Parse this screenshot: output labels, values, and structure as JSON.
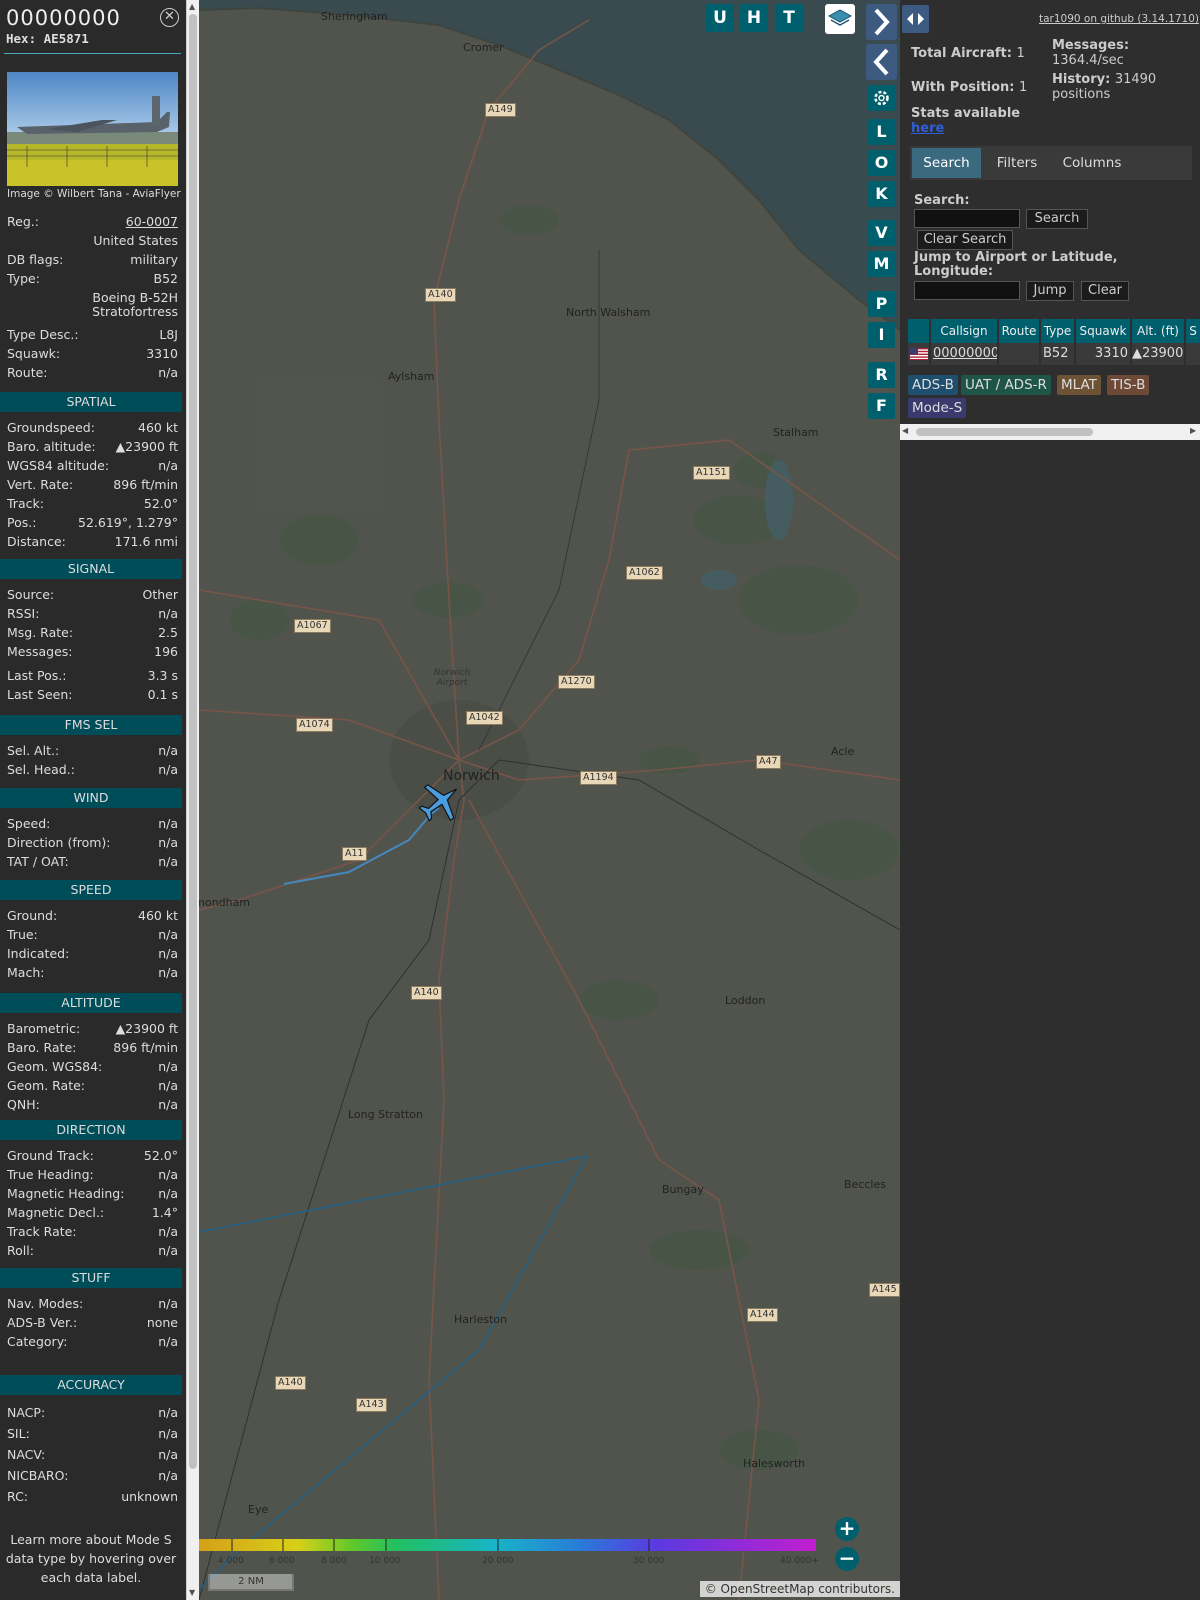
{
  "aircraft": {
    "callsign": "00000000",
    "hex_label": "Hex:",
    "hex": "AE5871",
    "close_icon": "close-icon",
    "photo_credit": "Image © Wilbert Tana - AviaFlyer"
  },
  "sidebar": {
    "rows_top": [
      {
        "label": "Reg.:",
        "value": "60-0007",
        "link": true
      },
      {
        "label": "",
        "value": "United States"
      },
      {
        "label": "DB flags:",
        "value": "military"
      },
      {
        "label": "Type:",
        "value": "B52"
      },
      {
        "label": "",
        "value": "Boeing B-52H"
      },
      {
        "label": "",
        "value": "Stratofortress"
      },
      {
        "label": "Type Desc.:",
        "value": "L8J"
      },
      {
        "label": "Squawk:",
        "value": "3310"
      },
      {
        "label": "Route:",
        "value": "n/a"
      }
    ],
    "sections": [
      {
        "title": "SPATIAL",
        "rows": [
          {
            "label": "Groundspeed:",
            "value": "460 kt"
          },
          {
            "label": "Baro. altitude:",
            "value": "▲23900 ft"
          },
          {
            "label": "WGS84 altitude:",
            "value": "n/a"
          },
          {
            "label": "Vert. Rate:",
            "value": "896 ft/min"
          },
          {
            "label": "Track:",
            "value": "52.0°"
          },
          {
            "label": "Pos.:",
            "value": "52.619°, 1.279°"
          },
          {
            "label": "Distance:",
            "value": "171.6 nmi"
          }
        ]
      },
      {
        "title": "SIGNAL",
        "rows": [
          {
            "label": "Source:",
            "value": "Other"
          },
          {
            "label": "RSSI:",
            "value": "n/a"
          },
          {
            "label": "Msg. Rate:",
            "value": "2.5"
          },
          {
            "label": "Messages:",
            "value": "196"
          },
          {
            "label": "Last Pos.:",
            "value": "3.3 s"
          },
          {
            "label": "Last Seen:",
            "value": "0.1 s"
          }
        ]
      },
      {
        "title": "FMS SEL",
        "rows": [
          {
            "label": "Sel. Alt.:",
            "value": "n/a"
          },
          {
            "label": "Sel. Head.:",
            "value": "n/a"
          }
        ]
      },
      {
        "title": "WIND",
        "rows": [
          {
            "label": "Speed:",
            "value": "n/a"
          },
          {
            "label": "Direction (from):",
            "value": "n/a"
          },
          {
            "label": "TAT / OAT:",
            "value": "n/a"
          }
        ]
      },
      {
        "title": "SPEED",
        "rows": [
          {
            "label": "Ground:",
            "value": "460 kt"
          },
          {
            "label": "True:",
            "value": "n/a"
          },
          {
            "label": "Indicated:",
            "value": "n/a"
          },
          {
            "label": "Mach:",
            "value": "n/a"
          }
        ]
      },
      {
        "title": "ALTITUDE",
        "rows": [
          {
            "label": "Barometric:",
            "value": "▲23900 ft"
          },
          {
            "label": "Baro. Rate:",
            "value": "896 ft/min"
          },
          {
            "label": "Geom. WGS84:",
            "value": "n/a"
          },
          {
            "label": "Geom. Rate:",
            "value": "n/a"
          },
          {
            "label": "QNH:",
            "value": "n/a"
          }
        ]
      },
      {
        "title": "DIRECTION",
        "rows": [
          {
            "label": "Ground Track:",
            "value": "52.0°"
          },
          {
            "label": "True Heading:",
            "value": "n/a"
          },
          {
            "label": "Magnetic Heading:",
            "value": "n/a"
          },
          {
            "label": "Magnetic Decl.:",
            "value": "1.4°"
          },
          {
            "label": "Track Rate:",
            "value": "n/a"
          },
          {
            "label": "Roll:",
            "value": "n/a"
          }
        ]
      },
      {
        "title": "STUFF",
        "rows": [
          {
            "label": "Nav. Modes:",
            "value": "n/a"
          },
          {
            "label": "ADS-B Ver.:",
            "value": "none"
          },
          {
            "label": "Category:",
            "value": "n/a"
          }
        ]
      },
      {
        "title": "ACCURACY",
        "rows": [
          {
            "label": "NACP:",
            "value": "n/a"
          },
          {
            "label": "SIL:",
            "value": "n/a"
          },
          {
            "label": "NACV:",
            "value": "n/a"
          },
          {
            "label": "NICBARO:",
            "value": "n/a"
          },
          {
            "label": "RC:",
            "value": "unknown"
          }
        ]
      }
    ],
    "learn_more": "Learn more about Mode S data type by hovering over each data label."
  },
  "map": {
    "top_buttons": [
      "U",
      "H",
      "T"
    ],
    "layers_icon": "layers-icon",
    "expand_icon": "chevron-right-icon",
    "collapse_icon": "chevron-left-icon",
    "settings_icon": "gear-icon",
    "right_buttons": [
      "L",
      "O",
      "K",
      "V",
      "M",
      "P",
      "I",
      "R",
      "F"
    ],
    "towns": [
      "Sheringham",
      "Cromer",
      "North Walsham",
      "Aylsham",
      "Stalham",
      "Norwich",
      "Norwich Airport",
      "Acle",
      "Wymondham",
      "Loddon",
      "Long Stratton",
      "Bungay",
      "Beccles",
      "Harleston",
      "Halesworth",
      "Eye"
    ],
    "roads": [
      "A149",
      "A140",
      "A1151",
      "A1062",
      "A1067",
      "A1270",
      "A1042",
      "A1074",
      "A1194",
      "A47",
      "A11",
      "A140",
      "A144",
      "A145",
      "A143",
      "A140"
    ],
    "altitude_legend_ticks": [
      "4 000",
      "6 000",
      "8 000",
      "10 000",
      "20 000",
      "30 000",
      "40 000+"
    ],
    "zoom_in": "+",
    "zoom_out": "−",
    "scale_label": "2 NM",
    "attribution": "© OpenStreetMap contributors.",
    "aircraft_icon": "airplane-icon"
  },
  "panel": {
    "toggle_icon": "split-arrows-icon",
    "github_link": "tar1090 on github (3.14.1710)",
    "total_aircraft_label": "Total Aircraft:",
    "total_aircraft": "1",
    "with_position_label": "With Position:",
    "with_position": "1",
    "stats_label": "Stats available",
    "stats_link": "here",
    "messages_label": "Messages:",
    "messages_value": "1364.4/sec",
    "history_label": "History:",
    "history_value": "31490",
    "history_unit": "positions",
    "tabs": [
      "Search",
      "Filters",
      "Columns"
    ],
    "search_label": "Search:",
    "search_button": "Search",
    "clear_search_button": "Clear Search",
    "jump_label": "Jump to Airport or Latitude, Longitude:",
    "jump_button": "Jump",
    "clear_button": "Clear",
    "table": {
      "columns": [
        "",
        "Callsign",
        "Route",
        "Type",
        "Squawk",
        "Alt. (ft)",
        "S"
      ],
      "rows": [
        {
          "flag_icon": "us-flag-icon",
          "callsign": "00000000",
          "route": "",
          "type": "B52",
          "squawk": "3310",
          "alt": "▲23900"
        }
      ]
    },
    "sources": [
      "ADS-B",
      "UAT / ADS-R",
      "MLAT",
      "TIS-B",
      "Mode-S"
    ]
  },
  "colors": {
    "teal_header": "#004d5a",
    "button_teal": "#005f6d",
    "active_tab": "#3b6a7f",
    "track_blue": "#4a9ee0"
  }
}
